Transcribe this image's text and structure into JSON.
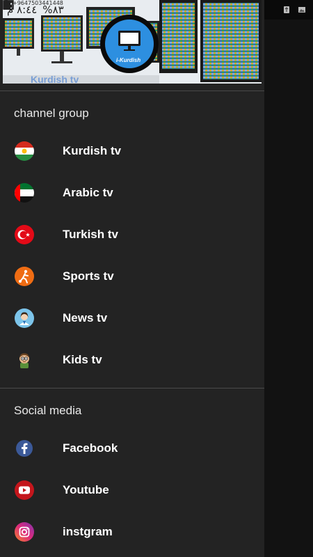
{
  "status_bar": {
    "time": "٨:٤٤ م",
    "battery": "%٨٣",
    "phone": "+9647503441448"
  },
  "header": {
    "logo_text": "i-Kurdish"
  },
  "channel_group": {
    "title": "channel group",
    "items": [
      {
        "label": "Kurdish tv",
        "icon": "kurdistan-flag-icon"
      },
      {
        "label": "Arabic tv",
        "icon": "uae-flag-icon"
      },
      {
        "label": "Turkish tv",
        "icon": "turkey-flag-icon"
      },
      {
        "label": "Sports tv",
        "icon": "sports-icon"
      },
      {
        "label": "News tv",
        "icon": "news-anchor-icon"
      },
      {
        "label": "Kids tv",
        "icon": "kids-icon"
      }
    ]
  },
  "social_media": {
    "title": "Social media",
    "items": [
      {
        "label": "Facebook",
        "icon": "facebook-icon"
      },
      {
        "label": "Youtube",
        "icon": "youtube-icon"
      },
      {
        "label": "instgram",
        "icon": "instagram-icon"
      }
    ]
  },
  "colors": {
    "drawer_bg": "#232323",
    "divider": "#4a4a4a",
    "facebook": "#3b5998",
    "youtube": "#e62117",
    "instagram": "#d6246e"
  }
}
